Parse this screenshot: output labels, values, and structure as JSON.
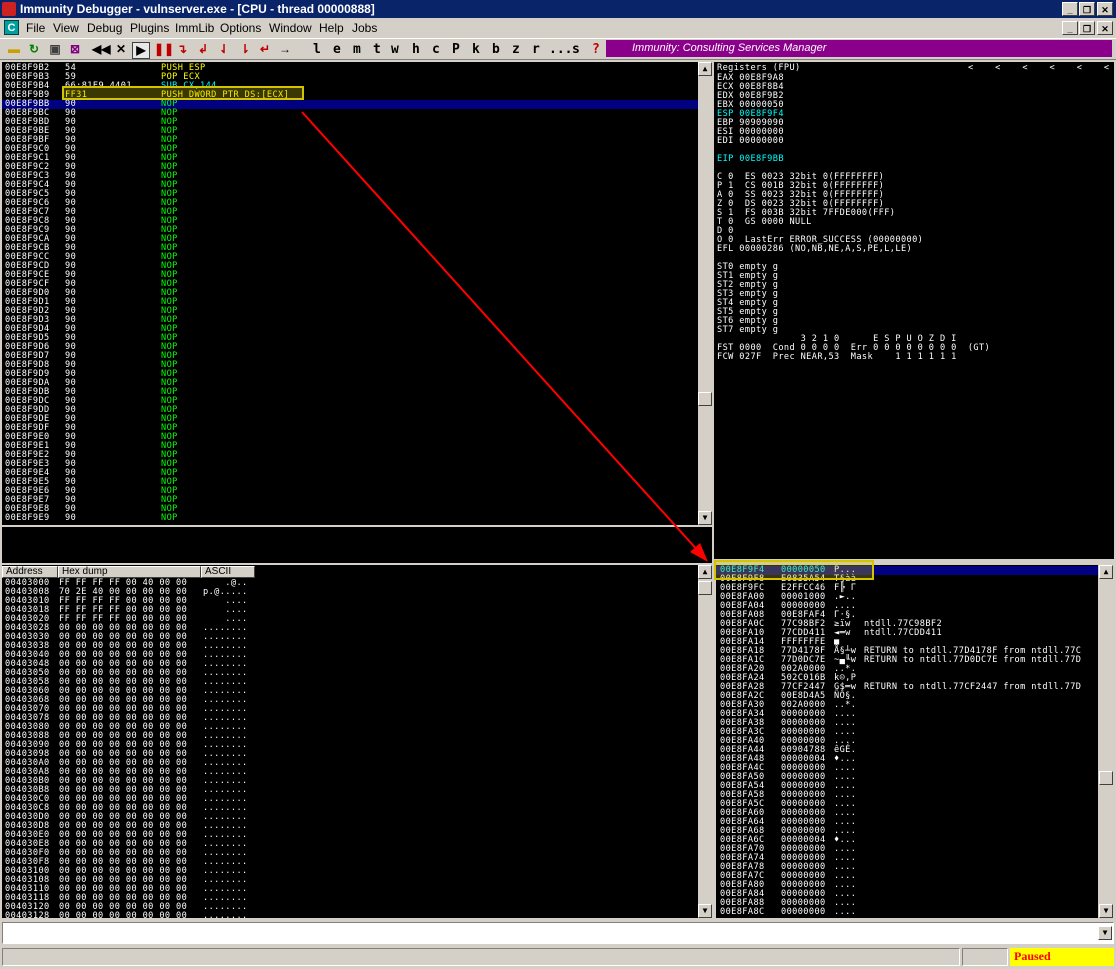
{
  "window": {
    "title": "Immunity Debugger - vulnserver.exe - [CPU - thread 00000888]"
  },
  "menu": [
    "File",
    "View",
    "Debug",
    "Plugins",
    "ImmLib",
    "Options",
    "Window",
    "Help",
    "Jobs"
  ],
  "toolbar": {
    "letters": [
      "l",
      "e",
      "m",
      "t",
      "w",
      "h",
      "c",
      "P",
      "k",
      "b",
      "z",
      "r",
      "...",
      "s",
      "?"
    ]
  },
  "banner": {
    "text": "Immunity: Consulting Services Manager"
  },
  "disasm": [
    {
      "addr": "00E8F9B2",
      "hex": "54",
      "instr": "PUSH ESP"
    },
    {
      "addr": "00E8F9B3",
      "hex": "59",
      "instr": "POP ECX"
    },
    {
      "addr": "00E8F9B4",
      "hex": "66:81E9 4401",
      "instr": "SUB CX,144"
    },
    {
      "addr": "00E8F9B9",
      "hex": "FF31",
      "instr": "PUSH DWORD PTR DS:[ECX]"
    },
    {
      "addr": "00E8F9BB",
      "hex": "90",
      "instr": "NOP"
    },
    {
      "addr": "00E8F9BC",
      "hex": "90",
      "instr": "NOP"
    },
    {
      "addr": "00E8F9BD",
      "hex": "90",
      "instr": "NOP"
    },
    {
      "addr": "00E8F9BE",
      "hex": "90",
      "instr": "NOP"
    },
    {
      "addr": "00E8F9BF",
      "hex": "90",
      "instr": "NOP"
    },
    {
      "addr": "00E8F9C0",
      "hex": "90",
      "instr": "NOP"
    },
    {
      "addr": "00E8F9C1",
      "hex": "90",
      "instr": "NOP"
    },
    {
      "addr": "00E8F9C2",
      "hex": "90",
      "instr": "NOP"
    },
    {
      "addr": "00E8F9C3",
      "hex": "90",
      "instr": "NOP"
    },
    {
      "addr": "00E8F9C4",
      "hex": "90",
      "instr": "NOP"
    },
    {
      "addr": "00E8F9C5",
      "hex": "90",
      "instr": "NOP"
    },
    {
      "addr": "00E8F9C6",
      "hex": "90",
      "instr": "NOP"
    },
    {
      "addr": "00E8F9C7",
      "hex": "90",
      "instr": "NOP"
    },
    {
      "addr": "00E8F9C8",
      "hex": "90",
      "instr": "NOP"
    },
    {
      "addr": "00E8F9C9",
      "hex": "90",
      "instr": "NOP"
    },
    {
      "addr": "00E8F9CA",
      "hex": "90",
      "instr": "NOP"
    },
    {
      "addr": "00E8F9CB",
      "hex": "90",
      "instr": "NOP"
    },
    {
      "addr": "00E8F9CC",
      "hex": "90",
      "instr": "NOP"
    },
    {
      "addr": "00E8F9CD",
      "hex": "90",
      "instr": "NOP"
    },
    {
      "addr": "00E8F9CE",
      "hex": "90",
      "instr": "NOP"
    },
    {
      "addr": "00E8F9CF",
      "hex": "90",
      "instr": "NOP"
    },
    {
      "addr": "00E8F9D0",
      "hex": "90",
      "instr": "NOP"
    },
    {
      "addr": "00E8F9D1",
      "hex": "90",
      "instr": "NOP"
    },
    {
      "addr": "00E8F9D2",
      "hex": "90",
      "instr": "NOP"
    },
    {
      "addr": "00E8F9D3",
      "hex": "90",
      "instr": "NOP"
    },
    {
      "addr": "00E8F9D4",
      "hex": "90",
      "instr": "NOP"
    },
    {
      "addr": "00E8F9D5",
      "hex": "90",
      "instr": "NOP"
    },
    {
      "addr": "00E8F9D6",
      "hex": "90",
      "instr": "NOP"
    },
    {
      "addr": "00E8F9D7",
      "hex": "90",
      "instr": "NOP"
    },
    {
      "addr": "00E8F9D8",
      "hex": "90",
      "instr": "NOP"
    },
    {
      "addr": "00E8F9D9",
      "hex": "90",
      "instr": "NOP"
    },
    {
      "addr": "00E8F9DA",
      "hex": "90",
      "instr": "NOP"
    },
    {
      "addr": "00E8F9DB",
      "hex": "90",
      "instr": "NOP"
    },
    {
      "addr": "00E8F9DC",
      "hex": "90",
      "instr": "NOP"
    },
    {
      "addr": "00E8F9DD",
      "hex": "90",
      "instr": "NOP"
    },
    {
      "addr": "00E8F9DE",
      "hex": "90",
      "instr": "NOP"
    },
    {
      "addr": "00E8F9DF",
      "hex": "90",
      "instr": "NOP"
    },
    {
      "addr": "00E8F9E0",
      "hex": "90",
      "instr": "NOP"
    },
    {
      "addr": "00E8F9E1",
      "hex": "90",
      "instr": "NOP"
    },
    {
      "addr": "00E8F9E2",
      "hex": "90",
      "instr": "NOP"
    },
    {
      "addr": "00E8F9E3",
      "hex": "90",
      "instr": "NOP"
    },
    {
      "addr": "00E8F9E4",
      "hex": "90",
      "instr": "NOP"
    },
    {
      "addr": "00E8F9E5",
      "hex": "90",
      "instr": "NOP"
    },
    {
      "addr": "00E8F9E6",
      "hex": "90",
      "instr": "NOP"
    },
    {
      "addr": "00E8F9E7",
      "hex": "90",
      "instr": "NOP"
    },
    {
      "addr": "00E8F9E8",
      "hex": "90",
      "instr": "NOP"
    },
    {
      "addr": "00E8F9E9",
      "hex": "90",
      "instr": "NOP"
    }
  ],
  "registers": {
    "header": "Registers (FPU)",
    "lines": [
      [
        "EAX 00E8F9A8",
        "w"
      ],
      [
        "ECX 00E8F8B4",
        "w"
      ],
      [
        "EDX 00E8F9B2",
        "w"
      ],
      [
        "EBX 00000050",
        "w"
      ],
      [
        "ESP 00E8F9F4",
        "c"
      ],
      [
        "EBP 90909090",
        "w"
      ],
      [
        "ESI 00000000",
        "w"
      ],
      [
        "EDI 00000000",
        "w"
      ],
      [
        "",
        "w"
      ],
      [
        "EIP 00E8F9BB",
        "c"
      ],
      [
        "",
        "w"
      ],
      [
        "C 0  ES 0023 32bit 0(FFFFFFFF)",
        "w"
      ],
      [
        "P 1  CS 001B 32bit 0(FFFFFFFF)",
        "w"
      ],
      [
        "A 0  SS 0023 32bit 0(FFFFFFFF)",
        "w"
      ],
      [
        "Z 0  DS 0023 32bit 0(FFFFFFFF)",
        "w"
      ],
      [
        "S 1  FS 003B 32bit 7FFDE000(FFF)",
        "w"
      ],
      [
        "T 0  GS 0000 NULL",
        "w"
      ],
      [
        "D 0",
        "w"
      ],
      [
        "O 0  LastErr ERROR_SUCCESS (00000000)",
        "w"
      ],
      [
        "EFL 00000286 (NO,NB,NE,A,S,PE,L,LE)",
        "w"
      ],
      [
        "",
        "w"
      ],
      [
        "ST0 empty g",
        "w"
      ],
      [
        "ST1 empty g",
        "w"
      ],
      [
        "ST2 empty g",
        "w"
      ],
      [
        "ST3 empty g",
        "w"
      ],
      [
        "ST4 empty g",
        "w"
      ],
      [
        "ST5 empty g",
        "w"
      ],
      [
        "ST6 empty g",
        "w"
      ],
      [
        "ST7 empty g",
        "w"
      ],
      [
        "               3 2 1 0      E S P U O Z D I",
        "w"
      ],
      [
        "FST 0000  Cond 0 0 0 0  Err 0 0 0 0 0 0 0 0  (GT)",
        "w"
      ],
      [
        "FCW 027F  Prec NEAR,53  Mask    1 1 1 1 1 1",
        "w"
      ]
    ]
  },
  "dump": {
    "headers": [
      "Address",
      "Hex dump",
      "ASCII"
    ],
    "rows": [
      [
        "00403000",
        "FF FF FF FF 00 40 00 00",
        "    .@.."
      ],
      [
        "00403008",
        "70 2E 40 00 00 00 00 00",
        "p.@....."
      ],
      [
        "00403010",
        "FF FF FF FF 00 00 00 00",
        "    ...."
      ],
      [
        "00403018",
        "FF FF FF FF 00 00 00 00",
        "    ...."
      ],
      [
        "00403020",
        "FF FF FF FF 00 00 00 00",
        "    ...."
      ],
      [
        "00403028",
        "00 00 00 00 00 00 00 00",
        "........"
      ],
      [
        "00403030",
        "00 00 00 00 00 00 00 00",
        "........"
      ],
      [
        "00403038",
        "00 00 00 00 00 00 00 00",
        "........"
      ],
      [
        "00403040",
        "00 00 00 00 00 00 00 00",
        "........"
      ],
      [
        "00403048",
        "00 00 00 00 00 00 00 00",
        "........"
      ],
      [
        "00403050",
        "00 00 00 00 00 00 00 00",
        "........"
      ],
      [
        "00403058",
        "00 00 00 00 00 00 00 00",
        "........"
      ],
      [
        "00403060",
        "00 00 00 00 00 00 00 00",
        "........"
      ],
      [
        "00403068",
        "00 00 00 00 00 00 00 00",
        "........"
      ],
      [
        "00403070",
        "00 00 00 00 00 00 00 00",
        "........"
      ],
      [
        "00403078",
        "00 00 00 00 00 00 00 00",
        "........"
      ],
      [
        "00403080",
        "00 00 00 00 00 00 00 00",
        "........"
      ],
      [
        "00403088",
        "00 00 00 00 00 00 00 00",
        "........"
      ],
      [
        "00403090",
        "00 00 00 00 00 00 00 00",
        "........"
      ],
      [
        "00403098",
        "00 00 00 00 00 00 00 00",
        "........"
      ],
      [
        "004030A0",
        "00 00 00 00 00 00 00 00",
        "........"
      ],
      [
        "004030A8",
        "00 00 00 00 00 00 00 00",
        "........"
      ],
      [
        "004030B0",
        "00 00 00 00 00 00 00 00",
        "........"
      ],
      [
        "004030B8",
        "00 00 00 00 00 00 00 00",
        "........"
      ],
      [
        "004030C0",
        "00 00 00 00 00 00 00 00",
        "........"
      ],
      [
        "004030C8",
        "00 00 00 00 00 00 00 00",
        "........"
      ],
      [
        "004030D0",
        "00 00 00 00 00 00 00 00",
        "........"
      ],
      [
        "004030D8",
        "00 00 00 00 00 00 00 00",
        "........"
      ],
      [
        "004030E0",
        "00 00 00 00 00 00 00 00",
        "........"
      ],
      [
        "004030E8",
        "00 00 00 00 00 00 00 00",
        "........"
      ],
      [
        "004030F0",
        "00 00 00 00 00 00 00 00",
        "........"
      ],
      [
        "004030F8",
        "00 00 00 00 00 00 00 00",
        "........"
      ],
      [
        "00403100",
        "00 00 00 00 00 00 00 00",
        "........"
      ],
      [
        "00403108",
        "00 00 00 00 00 00 00 00",
        "........"
      ],
      [
        "00403110",
        "00 00 00 00 00 00 00 00",
        "........"
      ],
      [
        "00403118",
        "00 00 00 00 00 00 00 00",
        "........"
      ],
      [
        "00403120",
        "00 00 00 00 00 00 00 00",
        "........"
      ],
      [
        "00403128",
        "00 00 00 00 00 00 00 00",
        "........"
      ]
    ]
  },
  "stack": [
    [
      "00E8F9F4",
      "00000050",
      "P...",
      ""
    ],
    [
      "00E8F9F8",
      "E0835A54",
      "T§àà",
      ""
    ],
    [
      "00E8F9FC",
      "E2FFCC46",
      "F╠ Γ",
      ""
    ],
    [
      "00E8FA00",
      "00001000",
      ".►..",
      ""
    ],
    [
      "00E8FA04",
      "00000000",
      "....",
      ""
    ],
    [
      "00E8FA08",
      "00E8FAF4",
      "Γ·§.",
      ""
    ],
    [
      "00E8FA0C",
      "77C98BF2",
      "≥ïw",
      "ntdll.77C98BF2"
    ],
    [
      "00E8FA10",
      "77CDD411",
      "◄═w",
      "ntdll.77CDD411"
    ],
    [
      "00E8FA14",
      "FFFFFFFE",
      "■   ",
      ""
    ],
    [
      "00E8FA18",
      "77D4178F",
      "Å§┴w",
      "RETURN to ntdll.77D4178F from ntdll.77C"
    ],
    [
      "00E8FA1C",
      "77D0DC7E",
      "~▄╙w",
      "RETURN to ntdll.77D0DC7E from ntdll.77D"
    ],
    [
      "00E8FA20",
      "002A0000",
      "..*.",
      ""
    ],
    [
      "00E8FA24",
      "502C016B",
      "k☺,P",
      ""
    ],
    [
      "00E8FA28",
      "77CF2447",
      "G$═w",
      "RETURN to ntdll.77CF2447 from ntdll.77D"
    ],
    [
      "00E8FA2C",
      "00E8D4A5",
      "ÑÔ§.",
      ""
    ],
    [
      "00E8FA30",
      "002A0000",
      "..*.",
      ""
    ],
    [
      "00E8FA34",
      "00000000",
      "....",
      ""
    ],
    [
      "00E8FA38",
      "00000000",
      "....",
      ""
    ],
    [
      "00E8FA3C",
      "00000000",
      "....",
      ""
    ],
    [
      "00E8FA40",
      "00000000",
      "....",
      ""
    ],
    [
      "00E8FA44",
      "00904788",
      "êGÉ.",
      ""
    ],
    [
      "00E8FA48",
      "00000004",
      "♦...",
      ""
    ],
    [
      "00E8FA4C",
      "00000000",
      "....",
      ""
    ],
    [
      "00E8FA50",
      "00000000",
      "....",
      ""
    ],
    [
      "00E8FA54",
      "00000000",
      "....",
      ""
    ],
    [
      "00E8FA58",
      "00000000",
      "....",
      ""
    ],
    [
      "00E8FA5C",
      "00000000",
      "....",
      ""
    ],
    [
      "00E8FA60",
      "00000000",
      "....",
      ""
    ],
    [
      "00E8FA64",
      "00000000",
      "....",
      ""
    ],
    [
      "00E8FA68",
      "00000000",
      "....",
      ""
    ],
    [
      "00E8FA6C",
      "00000004",
      "♦...",
      ""
    ],
    [
      "00E8FA70",
      "00000000",
      "....",
      ""
    ],
    [
      "00E8FA74",
      "00000000",
      "....",
      ""
    ],
    [
      "00E8FA78",
      "00000000",
      "....",
      ""
    ],
    [
      "00E8FA7C",
      "00000000",
      "....",
      ""
    ],
    [
      "00E8FA80",
      "00000000",
      "....",
      ""
    ],
    [
      "00E8FA84",
      "00000000",
      "....",
      ""
    ],
    [
      "00E8FA88",
      "00000000",
      "....",
      ""
    ],
    [
      "00E8FA8C",
      "00000000",
      "....",
      ""
    ]
  ],
  "status": {
    "text": "Paused"
  },
  "colors": {
    "selection": "#000080",
    "highlight_box": "#d4c400",
    "arrow": "#ff0000",
    "nop_green": "#00ff00",
    "cyan": "#00ffff",
    "paused_bg": "#ffff00",
    "paused_fg": "#ff0000"
  }
}
